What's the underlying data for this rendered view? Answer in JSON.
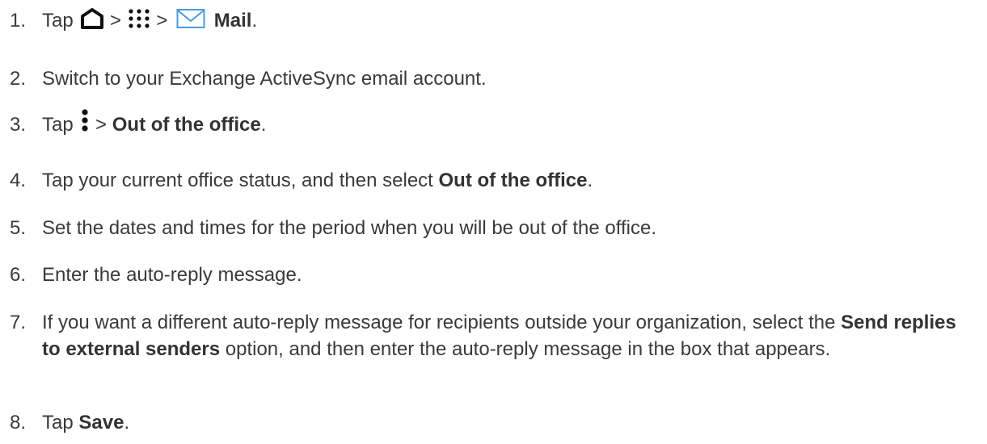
{
  "steps": [
    {
      "number": "1.",
      "tap": "Tap",
      "sep1": ">",
      "sep2": ">",
      "mail": "Mail",
      "end": "."
    },
    {
      "number": "2.",
      "text": "Switch to your Exchange ActiveSync email account."
    },
    {
      "number": "3.",
      "tap": "Tap",
      "sep": ">",
      "bold": "Out of the office",
      "end": "."
    },
    {
      "number": "4.",
      "before": "Tap your current office status, and then select ",
      "bold": "Out of the office",
      "end": "."
    },
    {
      "number": "5.",
      "text": "Set the dates and times for the period when you will be out of the office."
    },
    {
      "number": "6.",
      "text": "Enter the auto-reply message."
    },
    {
      "number": "7.",
      "before": "If you want a different auto-reply message for recipients outside your organization, select the ",
      "bold": "Send replies to external senders",
      "after": " option, and then enter the auto-reply message in the box that appears."
    },
    {
      "number": "8.",
      "tap": "Tap ",
      "bold": "Save",
      "end": "."
    }
  ],
  "icons": {
    "home": "home-icon",
    "apps": "apps-grid-icon",
    "mail": "mail-envelope-icon",
    "menu": "more-vertical-icon"
  },
  "colors": {
    "text": "#3a3a3a",
    "icon_dark": "#111111",
    "mail_icon": "#4a9ce0"
  }
}
